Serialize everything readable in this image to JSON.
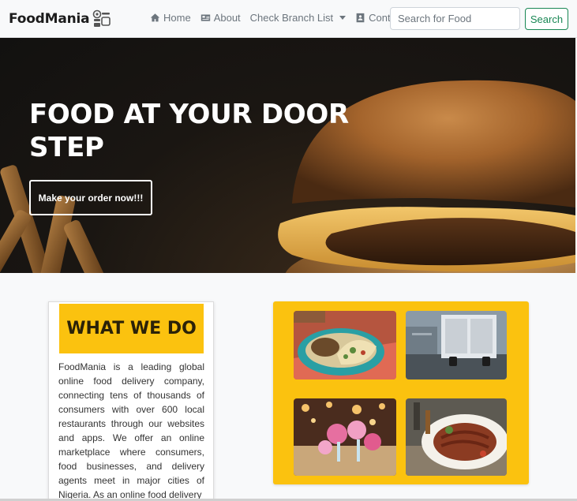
{
  "navbar": {
    "brand": "FoodMania",
    "links": [
      {
        "label": "Home",
        "icon": "home-icon"
      },
      {
        "label": "About",
        "icon": "id-card-icon"
      },
      {
        "label": "Check Branch List",
        "icon": "caret-down-icon"
      },
      {
        "label": "Contact",
        "icon": "contact-icon"
      }
    ],
    "search": {
      "placeholder": "Search for Food",
      "button_label": "Search"
    }
  },
  "hero": {
    "title": "FOOD AT YOUR DOOR STEP",
    "cta_label": "Make your order now!!!"
  },
  "about": {
    "title": "WHAT WE DO",
    "text": "FoodMania is a leading global online food delivery company, connecting tens of thousands of consumers with over 600 local restaurants through our websites and apps. We offer an online marketplace where consumers, food businesses, and delivery agents meet in major cities of Nigeria. As an online food delivery"
  },
  "gallery": {
    "images": [
      "tacos-plate",
      "delivery-truck",
      "restaurant-flowers",
      "steak-dinner"
    ]
  },
  "colors": {
    "accent": "#fbc20f",
    "search_green": "#198754",
    "navbar_bg": "#f8f9fa"
  }
}
